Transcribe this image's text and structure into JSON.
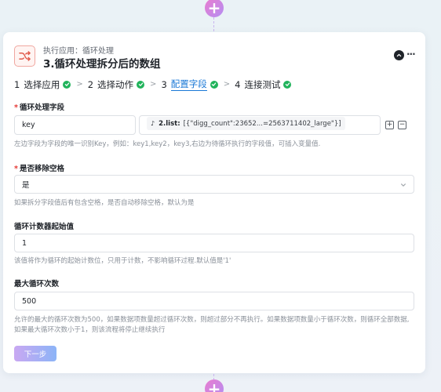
{
  "header": {
    "app_label": "执行应用：循环处理",
    "step_title": "3.循环处理拆分后的数组"
  },
  "steps": [
    {
      "num": "1",
      "label": "选择应用"
    },
    {
      "num": "2",
      "label": "选择动作"
    },
    {
      "num": "3",
      "label": "配置字段"
    },
    {
      "num": "4",
      "label": "连接测试"
    }
  ],
  "fields": {
    "loop_field": {
      "required_mark": "*",
      "label": "循环处理字段",
      "key_value": "key",
      "var_name": "2.list:",
      "var_value": "[{\"digg_count\":23652...=2563711402_large\"}]",
      "hint": "左边字段为字段的唯一识别Key，例如：key1,key2，key3,右边为待循环执行的字段值，可插入变量值."
    },
    "remove_spaces": {
      "required_mark": "*",
      "label": "是否移除空格",
      "value": "是",
      "hint": "如果拆分字段值后有包含空格，是否自动移除空格，默认为是"
    },
    "counter_start": {
      "label": "循环计数器起始值",
      "value": "1",
      "hint": "该值将作为循环的起始计数位，只用于计数，不影响循环过程.默认值是'1'"
    },
    "max_loops": {
      "label": "最大循环次数",
      "value": "500",
      "hint_line1": "允许的最大的循环次数为500，如果数据项数量超过循环次数，则超过部分不再执行。如果数据项数量小于循环次数，则循环全部数据,",
      "hint_line2": "如果最大循环次数小于1，则该流程将停止继续执行"
    }
  },
  "next_button": "下一步",
  "colors": {
    "accent": "#1a78d6",
    "check": "#21b35b",
    "required": "#e53935"
  },
  "icons": [
    "plus-icon",
    "shuffle-icon",
    "chevron-up-icon",
    "more-icon",
    "check-icon",
    "chevron-right-icon",
    "tiktok-icon",
    "add-square-icon",
    "minus-square-icon",
    "chevron-down-icon"
  ]
}
